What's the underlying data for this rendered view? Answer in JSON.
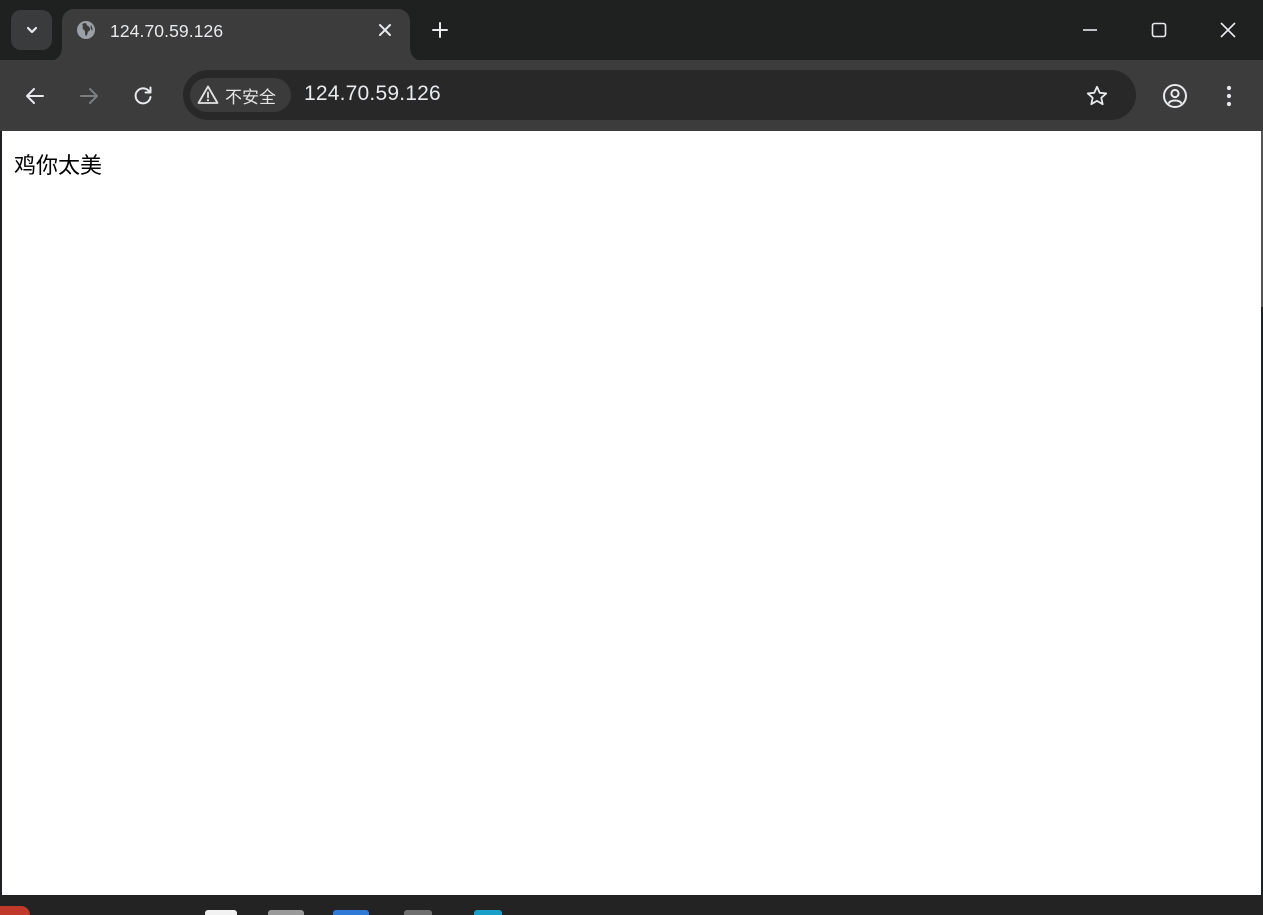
{
  "tab": {
    "title": "124.70.59.126"
  },
  "omnibox": {
    "security_label": "不安全",
    "url": "124.70.59.126"
  },
  "page": {
    "body_text": "鸡你太美"
  },
  "icons": {
    "tab_search": "chevron-down-icon",
    "favicon": "globe-icon",
    "tab_close": "close-icon",
    "new_tab": "plus-icon",
    "minimize": "minimize-icon",
    "maximize": "maximize-icon",
    "window_close": "close-icon",
    "back": "arrow-left-icon",
    "forward": "arrow-right-icon",
    "reload": "reload-icon",
    "security": "warning-triangle-icon",
    "bookmark": "star-icon",
    "profile": "profile-icon",
    "menu": "kebab-menu-icon"
  },
  "colors": {
    "tabstrip_bg": "#1f2020",
    "toolbar_bg": "#3c3c3c",
    "omnibox_bg": "#282828",
    "page_bg": "#ffffff"
  }
}
